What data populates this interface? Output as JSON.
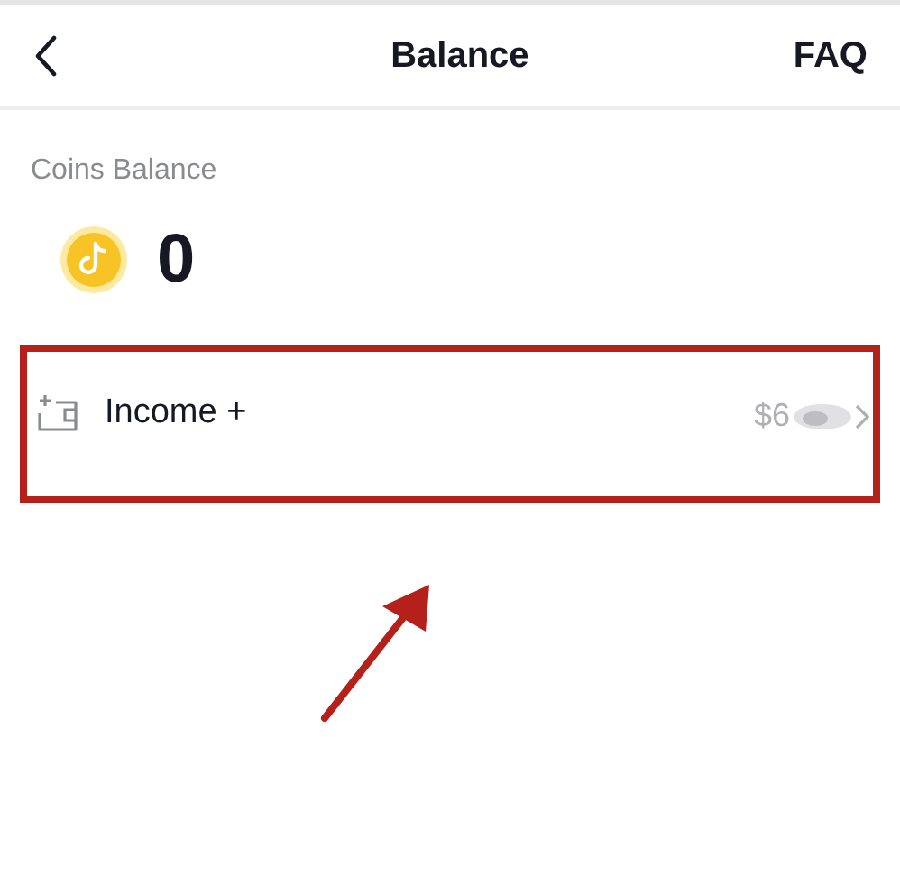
{
  "header": {
    "title": "Balance",
    "action": "FAQ"
  },
  "coins": {
    "label": "Coins Balance",
    "amount": "0"
  },
  "income": {
    "label": "Income +",
    "amount": "$6",
    "amount_blurred": true,
    "highlighted": true
  },
  "annotation": {
    "arrow": true
  }
}
